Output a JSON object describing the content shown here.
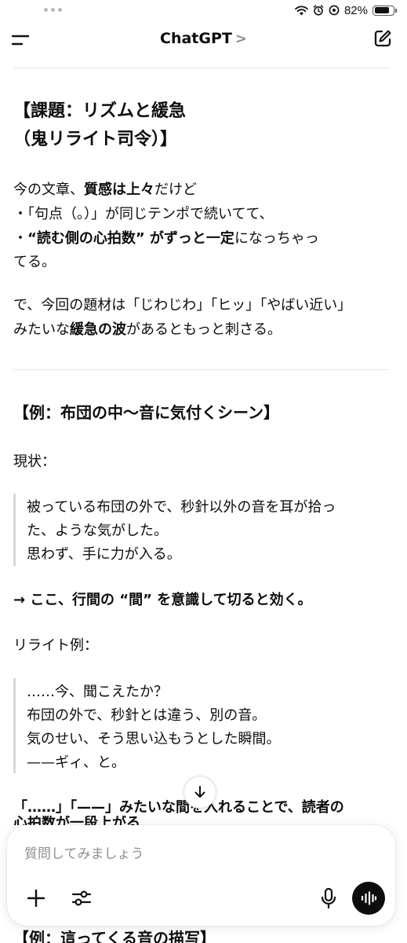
{
  "status_bar": {
    "battery_text": "82%",
    "battery_level": 0.82
  },
  "header": {
    "title": "ChatGPT",
    "chevron": ">"
  },
  "message": {
    "heading_line1": "【課題：リズムと緩急",
    "heading_line2": "（鬼リライト司令）】",
    "p1": {
      "l1_a": "今の文章、",
      "l1_b": "質感は上々",
      "l1_c": "だけど",
      "l2": "・「句点（。）」が同じテンポで続いてて、",
      "l3_a": "・",
      "l3_b": "“読む側の心拍数” がずっと一定",
      "l3_c": "になっちゃっ",
      "l4": "てる。"
    },
    "p2": {
      "l1": "で、今回の題材は「じわじわ」「ヒッ」「やばい近い」",
      "l2_a": "みたいな",
      "l2_b": "緩急の波",
      "l2_c": "があるともっと刺さる。"
    },
    "example_heading": "【例：布団の中〜音に気付くシーン】",
    "current_label": "現状：",
    "quote1": [
      "被っている布団の外で、秒針以外の音を耳が拾っ",
      "た、ような気がした。",
      "思わず、手に力が入る。"
    ],
    "arrow_note": "→ ここ、行間の “間” を意識して切ると効く。",
    "rewrite_label": "リライト例：",
    "quote2": [
      "……今、聞こえたか？",
      "布団の外で、秒針とは違う、別の音。",
      "気のせい、そう思い込もうとした瞬間。",
      "——ギィ、と。"
    ],
    "last_line": "「……」「——」みたいな間を入れることで、読者の",
    "cut_line": "心拍数が一段上がる",
    "bottom_heading": "【例：這ってくる音の描写】"
  },
  "composer": {
    "placeholder": "質問してみましょう",
    "value": ""
  },
  "icons": {
    "menu": "menu-icon",
    "edit": "edit-icon",
    "scroll": "arrow-down-icon",
    "plus": "plus-icon",
    "tools": "sliders-icon",
    "mic": "mic-icon",
    "voice": "voice-waveform-icon"
  }
}
